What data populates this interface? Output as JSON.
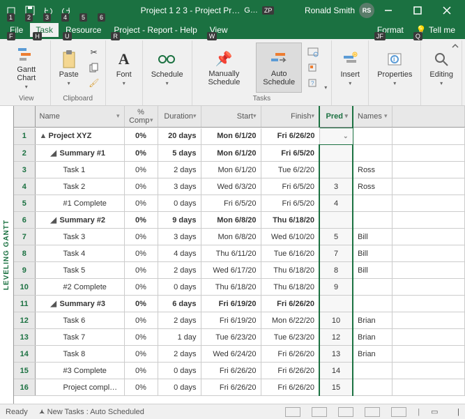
{
  "titlebar": {
    "qat_keys": [
      "1",
      "2",
      "3",
      "4",
      "5",
      "6"
    ],
    "title_left": "Project 1 2 3  -  Project Pr…",
    "title_mid_key": "ZP",
    "title_small": "G…",
    "user_name": "Ronald Smith",
    "user_initials": "RS"
  },
  "menu": {
    "file": "File",
    "task": "Task",
    "resource": "Resource",
    "prh": "Project - Report - Help",
    "view": "View",
    "format": "Format",
    "tell": "Tell me",
    "key_file": "F",
    "key_task": "H",
    "key_resource": "U",
    "key_report": "R",
    "key_view": "W",
    "key_format": "JF",
    "key_tell": "Q"
  },
  "ribbon": {
    "gantt": "Gantt\nChart",
    "paste": "Paste",
    "font": "Font",
    "schedule": "Schedule",
    "manual": "Manually\nSchedule",
    "auto": "Auto\nSchedule",
    "insert": "Insert",
    "properties": "Properties",
    "editing": "Editing",
    "grp_view": "View",
    "grp_clipboard": "Clipboard",
    "grp_tasks": "Tasks"
  },
  "columns": {
    "name": "Name",
    "comp": "%\nComp",
    "duration": "Duration",
    "start": "Start",
    "finish": "Finish",
    "pred": "Pred",
    "resnames": "Names"
  },
  "rows": [
    {
      "n": "1",
      "lvl": 0,
      "name": "Project XYZ",
      "comp": "0%",
      "dur": "20 days",
      "start": "Mon 6/1/20",
      "finish": "Fri 6/26/20",
      "pred": "",
      "res": "",
      "bold": true,
      "toggle": "▲"
    },
    {
      "n": "2",
      "lvl": 1,
      "name": "Summary #1",
      "comp": "0%",
      "dur": "5 days",
      "start": "Mon 6/1/20",
      "finish": "Fri 6/5/20",
      "pred": "",
      "res": "",
      "bold": true,
      "toggle": "◢"
    },
    {
      "n": "3",
      "lvl": 2,
      "name": "Task 1",
      "comp": "0%",
      "dur": "2 days",
      "start": "Mon 6/1/20",
      "finish": "Tue 6/2/20",
      "pred": "",
      "res": "Ross",
      "bold": false
    },
    {
      "n": "4",
      "lvl": 2,
      "name": "Task 2",
      "comp": "0%",
      "dur": "3 days",
      "start": "Wed 6/3/20",
      "finish": "Fri 6/5/20",
      "pred": "3",
      "res": "Ross",
      "bold": false
    },
    {
      "n": "5",
      "lvl": 2,
      "name": "#1 Complete",
      "comp": "0%",
      "dur": "0 days",
      "start": "Fri 6/5/20",
      "finish": "Fri 6/5/20",
      "pred": "4",
      "res": "",
      "bold": false
    },
    {
      "n": "6",
      "lvl": 1,
      "name": "Summary #2",
      "comp": "0%",
      "dur": "9 days",
      "start": "Mon 6/8/20",
      "finish": "Thu 6/18/20",
      "pred": "",
      "res": "",
      "bold": true,
      "toggle": "◢"
    },
    {
      "n": "7",
      "lvl": 2,
      "name": "Task 3",
      "comp": "0%",
      "dur": "3 days",
      "start": "Mon 6/8/20",
      "finish": "Wed 6/10/20",
      "pred": "5",
      "res": "Bill",
      "bold": false
    },
    {
      "n": "8",
      "lvl": 2,
      "name": "Task 4",
      "comp": "0%",
      "dur": "4 days",
      "start": "Thu 6/11/20",
      "finish": "Tue 6/16/20",
      "pred": "7",
      "res": "Bill",
      "bold": false
    },
    {
      "n": "9",
      "lvl": 2,
      "name": "Task 5",
      "comp": "0%",
      "dur": "2 days",
      "start": "Wed 6/17/20",
      "finish": "Thu 6/18/20",
      "pred": "8",
      "res": "Bill",
      "bold": false
    },
    {
      "n": "10",
      "lvl": 2,
      "name": "#2 Complete",
      "comp": "0%",
      "dur": "0 days",
      "start": "Thu 6/18/20",
      "finish": "Thu 6/18/20",
      "pred": "9",
      "res": "",
      "bold": false
    },
    {
      "n": "11",
      "lvl": 1,
      "name": "Summary #3",
      "comp": "0%",
      "dur": "6 days",
      "start": "Fri 6/19/20",
      "finish": "Fri 6/26/20",
      "pred": "",
      "res": "",
      "bold": true,
      "toggle": "◢"
    },
    {
      "n": "12",
      "lvl": 2,
      "name": "Task 6",
      "comp": "0%",
      "dur": "2 days",
      "start": "Fri 6/19/20",
      "finish": "Mon 6/22/20",
      "pred": "10",
      "res": "Brian",
      "bold": false
    },
    {
      "n": "13",
      "lvl": 2,
      "name": "Task 7",
      "comp": "0%",
      "dur": "1 day",
      "start": "Tue 6/23/20",
      "finish": "Tue 6/23/20",
      "pred": "12",
      "res": "Brian",
      "bold": false
    },
    {
      "n": "14",
      "lvl": 2,
      "name": "Task 8",
      "comp": "0%",
      "dur": "2 days",
      "start": "Wed 6/24/20",
      "finish": "Fri 6/26/20",
      "pred": "13",
      "res": "Brian",
      "bold": false
    },
    {
      "n": "15",
      "lvl": 2,
      "name": "#3 Complete",
      "comp": "0%",
      "dur": "0 days",
      "start": "Fri 6/26/20",
      "finish": "Fri 6/26/20",
      "pred": "14",
      "res": "",
      "bold": false
    },
    {
      "n": "16",
      "lvl": 2,
      "name": "Project completed",
      "comp": "0%",
      "dur": "0 days",
      "start": "Fri 6/26/20",
      "finish": "Fri 6/26/20",
      "pred": "15",
      "res": "",
      "bold": false
    }
  ],
  "leftlabel": "LEVELING GANTT",
  "statusbar": {
    "ready": "Ready",
    "newtasks": "New Tasks : Auto Scheduled"
  }
}
